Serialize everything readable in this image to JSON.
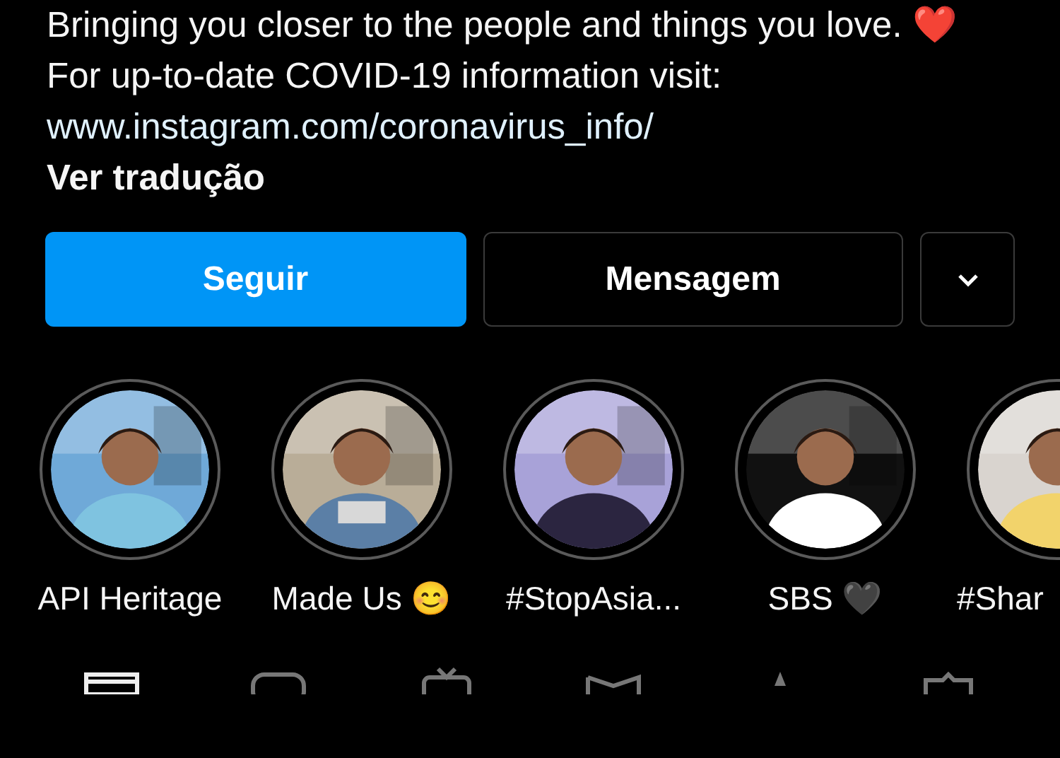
{
  "bio": {
    "lines": [
      "Bringing you closer to the people and things you love. ❤️",
      "For up-to-date COVID-19 information visit:"
    ],
    "link": "www.instagram.com/coronavirus_info/",
    "translate": "Ver tradução"
  },
  "buttons": {
    "follow": "Seguir",
    "message": "Mensagem"
  },
  "highlights": [
    {
      "label": "API Heritage"
    },
    {
      "label": "Made Us 😊"
    },
    {
      "label": "#StopAsia..."
    },
    {
      "label": "SBS 🖤"
    },
    {
      "label": "#Shar"
    }
  ]
}
